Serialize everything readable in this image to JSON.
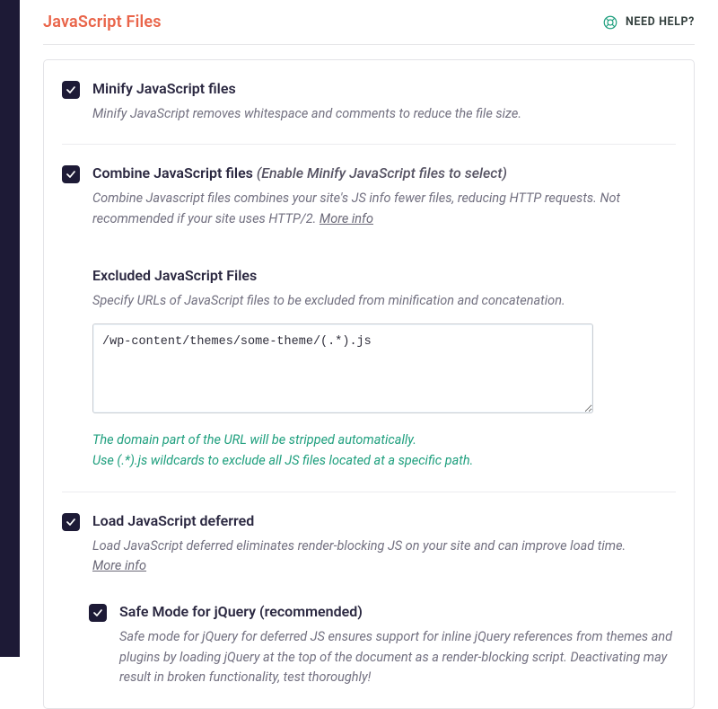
{
  "header": {
    "title": "JavaScript Files",
    "help_label": "NEED HELP?"
  },
  "options": {
    "minify": {
      "title": "Minify JavaScript files",
      "desc": "Minify JavaScript removes whitespace and comments to reduce the file size."
    },
    "combine": {
      "title": "Combine JavaScript files",
      "title_meta": "(Enable Minify JavaScript files to select)",
      "desc": "Combine Javascript files combines your site's JS info fewer files, reducing HTTP requests. Not recommended if your site uses HTTP/2.",
      "more": "More info"
    },
    "excluded": {
      "title": "Excluded JavaScript Files",
      "desc": "Specify URLs of JavaScript files to be excluded from minification and concatenation.",
      "value": "/wp-content/themes/some-theme/(.*).js",
      "hint1": "The domain part of the URL will be stripped automatically.",
      "hint2": "Use (.*).js wildcards to exclude all JS files located at a specific path."
    },
    "defer": {
      "title": "Load JavaScript deferred",
      "desc": "Load JavaScript deferred eliminates render-blocking JS on your site and can improve load time.",
      "more": "More info"
    },
    "safemode": {
      "title": "Safe Mode for jQuery (recommended)",
      "desc": "Safe mode for jQuery for deferred JS ensures support for inline jQuery references from themes and plugins by loading jQuery at the top of the document as a render-blocking script. Deactivating may result in broken functionality, test thoroughly!"
    }
  }
}
